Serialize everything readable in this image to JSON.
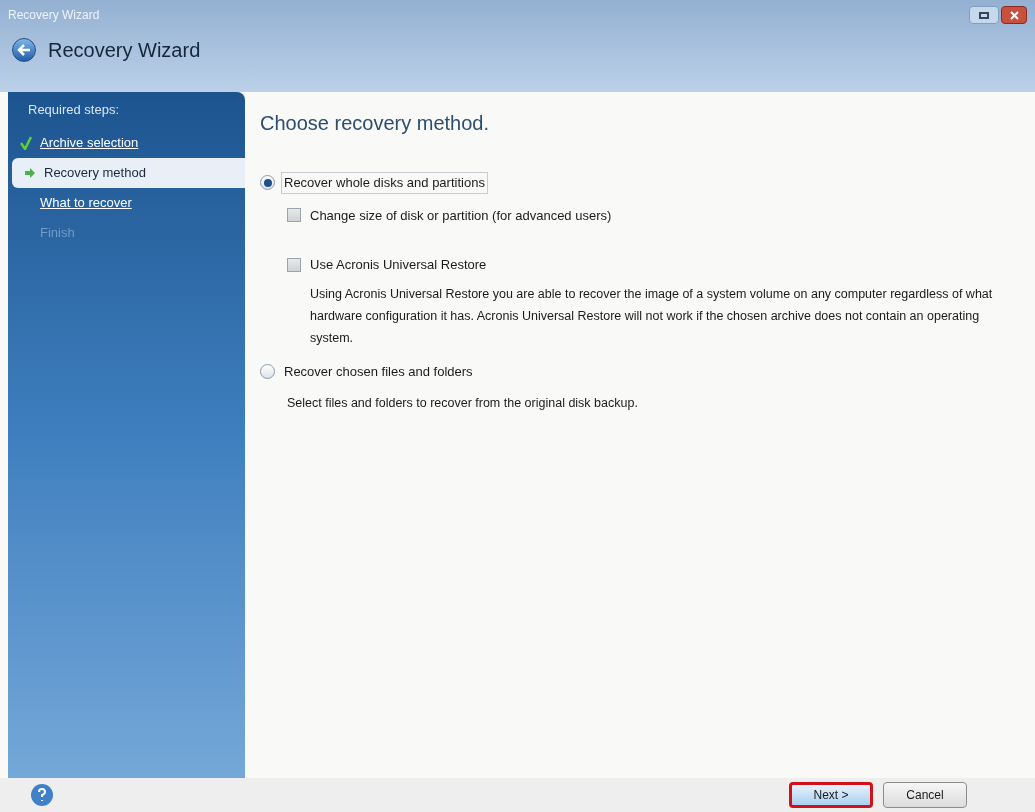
{
  "window": {
    "title": "Recovery Wizard"
  },
  "header": {
    "title": "Recovery Wizard"
  },
  "sidebar": {
    "heading": "Required steps:",
    "steps": [
      {
        "label": "Archive selection",
        "kind": "done"
      },
      {
        "label": "Recovery method",
        "kind": "current"
      },
      {
        "label": "What to recover",
        "kind": "pending"
      },
      {
        "label": "Finish",
        "kind": "disabled"
      }
    ]
  },
  "content": {
    "title": "Choose recovery method.",
    "options": [
      {
        "label": "Recover whole disks and partitions",
        "selected": true,
        "focused": true,
        "checkboxes": [
          {
            "label": "Change size of disk or partition (for advanced users)",
            "checked": false
          },
          {
            "label": "Use Acronis Universal Restore",
            "checked": false,
            "description": "Using Acronis Universal Restore you are able to recover the image of a system volume on any computer regardless of what hardware configuration it has. Acronis Universal Restore will not work if the chosen archive does not contain an operating system."
          }
        ]
      },
      {
        "label": "Recover chosen files and folders",
        "selected": false,
        "focused": false,
        "description": "Select files and folders to recover from the original disk backup."
      }
    ]
  },
  "footer": {
    "buttons": [
      {
        "label": "Next >",
        "highlighted": true
      },
      {
        "label": "Cancel",
        "highlighted": false
      }
    ]
  }
}
